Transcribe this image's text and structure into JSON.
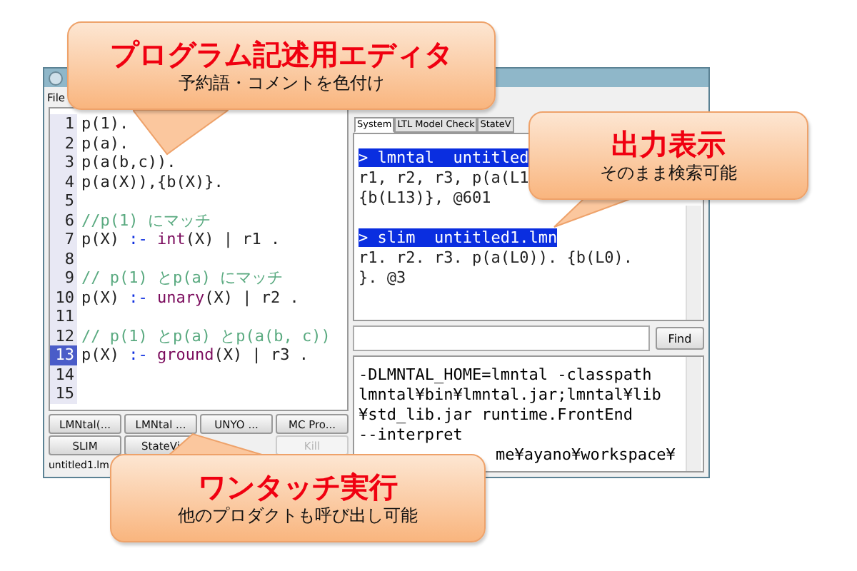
{
  "window": {
    "menu": [
      "File"
    ]
  },
  "editor": {
    "lines": [
      {
        "num": "1",
        "selected": false,
        "segments": [
          {
            "kind": "text",
            "text": "p(1)."
          }
        ]
      },
      {
        "num": "2",
        "selected": false,
        "segments": [
          {
            "kind": "text",
            "text": "p(a)."
          }
        ]
      },
      {
        "num": "3",
        "selected": false,
        "segments": [
          {
            "kind": "text",
            "text": "p(a(b,c))."
          }
        ]
      },
      {
        "num": "4",
        "selected": false,
        "segments": [
          {
            "kind": "text",
            "text": "p(a(X)),{b(X)}."
          }
        ]
      },
      {
        "num": "5",
        "selected": false
      },
      {
        "num": "6",
        "selected": false,
        "segments": [
          {
            "kind": "comment",
            "text": "//p(1) にマッチ"
          }
        ]
      },
      {
        "num": "7",
        "selected": false,
        "segments": [
          {
            "kind": "text",
            "text": "p(X) "
          },
          {
            "kind": "op",
            "text": ":- "
          },
          {
            "kind": "keyword",
            "text": "int"
          },
          {
            "kind": "text",
            "text": "(X) | r1 ."
          }
        ]
      },
      {
        "num": "8",
        "selected": false
      },
      {
        "num": "9",
        "selected": false,
        "segments": [
          {
            "kind": "comment",
            "text": "// p(1) とp(a) にマッチ"
          }
        ]
      },
      {
        "num": "10",
        "selected": false,
        "segments": [
          {
            "kind": "text",
            "text": "p(X) "
          },
          {
            "kind": "op",
            "text": ":- "
          },
          {
            "kind": "keyword",
            "text": "unary"
          },
          {
            "kind": "text",
            "text": "(X) | r2 ."
          }
        ]
      },
      {
        "num": "11",
        "selected": false
      },
      {
        "num": "12",
        "selected": false,
        "segments": [
          {
            "kind": "comment",
            "text": "// p(1) とp(a) とp(a(b, c))"
          }
        ]
      },
      {
        "num": "13",
        "selected": true,
        "segments": [
          {
            "kind": "text",
            "text": "p(X) "
          },
          {
            "kind": "op",
            "text": ":- "
          },
          {
            "kind": "keyword",
            "text": "ground"
          },
          {
            "kind": "text",
            "text": "(X) | r3 ."
          }
        ]
      },
      {
        "num": "14",
        "selected": false
      },
      {
        "num": "15",
        "selected": false
      }
    ],
    "buttons": [
      {
        "label": "LMNtal(...",
        "disabled": false
      },
      {
        "label": "LMNtal ...",
        "disabled": false
      },
      {
        "label": "UNYO ...",
        "disabled": false
      },
      {
        "label": "MC Pro...",
        "disabled": false
      },
      {
        "label": "SLIM",
        "disabled": false
      },
      {
        "label": "StateVi",
        "disabled": false
      },
      {
        "label": "Kill",
        "disabled": true
      }
    ],
    "status": "untitled1.lm"
  },
  "output": {
    "tabs": [
      {
        "label": "System",
        "selected": true
      },
      {
        "label": "LTL Model Check",
        "selected": false
      },
      {
        "label": "StateV",
        "selected": false
      }
    ],
    "blocks": [
      {
        "lines": [
          {
            "text": "> lmntal  untitled",
            "highlighted": true
          },
          {
            "text": "r1, r2, r3, p(a(L1",
            "highlighted": false
          },
          {
            "text": "{b(L13)}, @601",
            "highlighted": false
          }
        ]
      },
      {
        "lines": [
          {
            "text": "> slim  untitled1.lmn",
            "highlighted": true
          },
          {
            "text": "r1. r2. r3. p(a(L0)). {b(L0).",
            "highlighted": false
          },
          {
            "text": "}. @3",
            "highlighted": false
          }
        ]
      }
    ],
    "find_button": "Find",
    "console": [
      "-DLMNTAL_HOME=lmntal -classpath",
      "lmntal¥bin¥lmntal.jar;lmntal¥lib",
      "¥std_lib.jar runtime.FrontEnd",
      "--interpret",
      "me¥ayano¥workspace¥"
    ]
  },
  "callouts": [
    {
      "title": "プログラム記述用エディタ",
      "subtitle": "予約語・コメントを色付け"
    },
    {
      "title": "出力表示",
      "subtitle": "そのまま検索可能"
    },
    {
      "title": "ワンタッチ実行",
      "subtitle": "他のプロダクトも呼び出し可能"
    }
  ]
}
